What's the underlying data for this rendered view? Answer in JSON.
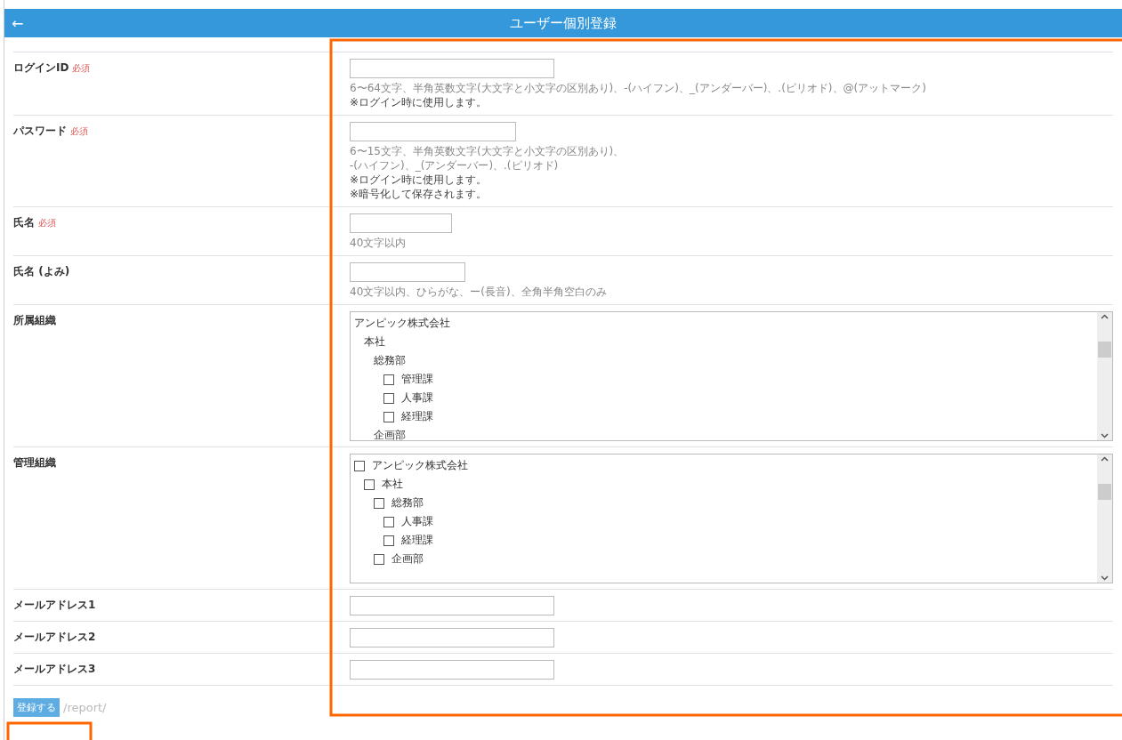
{
  "header": {
    "back_icon": "←",
    "title": "ユーザー個別登録"
  },
  "fields": [
    {
      "kind": "text",
      "label": "ログインID",
      "badge": "必須",
      "notes": [
        "6〜64文字、半角英数文字(大文字と小文字の区別あり)、-(ハイフン)、_(アンダーバー)、.(ピリオド)、@(アットマーク)",
        "※ログイン時に使用します。"
      ]
    },
    {
      "kind": "text",
      "label": "パスワード",
      "badge": "必須",
      "notes": [
        "6〜15文字、半角英数文字(大文字と小文字の区別あり)、",
        "-(ハイフン)、_(アンダーバー)、.(ピリオド)",
        "※ログイン時に使用します。",
        "※暗号化して保存されます。"
      ]
    },
    {
      "kind": "text",
      "label": "氏名",
      "badge": "必須",
      "notes": [
        "40文字以内"
      ]
    },
    {
      "kind": "text",
      "label": "氏名 (よみ)",
      "notes": [
        "40文字以内、ひらがな、ー(長音)、全角半角空白のみ"
      ]
    },
    {
      "kind": "tree",
      "label": "所属組織",
      "tree": [
        {
          "label": "アンピック株式会社",
          "kind": "plain",
          "children": [
            {
              "label": "本社",
              "kind": "plain",
              "children": [
                {
                  "label": "総務部",
                  "kind": "plain",
                  "children": [
                    {
                      "label": "管理課",
                      "kind": "check",
                      "checked": false
                    },
                    {
                      "label": "人事課",
                      "kind": "check",
                      "checked": false
                    },
                    {
                      "label": "経理課",
                      "kind": "check",
                      "checked": false
                    }
                  ]
                },
                {
                  "label": "企画部",
                  "kind": "plain"
                }
              ]
            }
          ]
        }
      ]
    },
    {
      "kind": "tree",
      "label": "管理組織",
      "tree": [
        {
          "label": "アンピック株式会社",
          "kind": "check",
          "checked": false,
          "children": [
            {
              "label": "本社",
              "kind": "check",
              "checked": false,
              "children": [
                {
                  "label": "総務部",
                  "kind": "check",
                  "checked": false,
                  "children": [
                    {
                      "label": "人事課",
                      "kind": "check",
                      "checked": false
                    },
                    {
                      "label": "経理課",
                      "kind": "check",
                      "checked": false
                    }
                  ]
                },
                {
                  "label": "企画部",
                  "kind": "check",
                  "checked": false
                }
              ]
            }
          ]
        }
      ]
    },
    {
      "kind": "text",
      "label": "メールアドレス1"
    },
    {
      "kind": "text",
      "label": "メールアドレス2"
    },
    {
      "kind": "text",
      "label": "メールアドレス3"
    }
  ],
  "footer": {
    "submit": "登録する",
    "path": "/report/"
  }
}
